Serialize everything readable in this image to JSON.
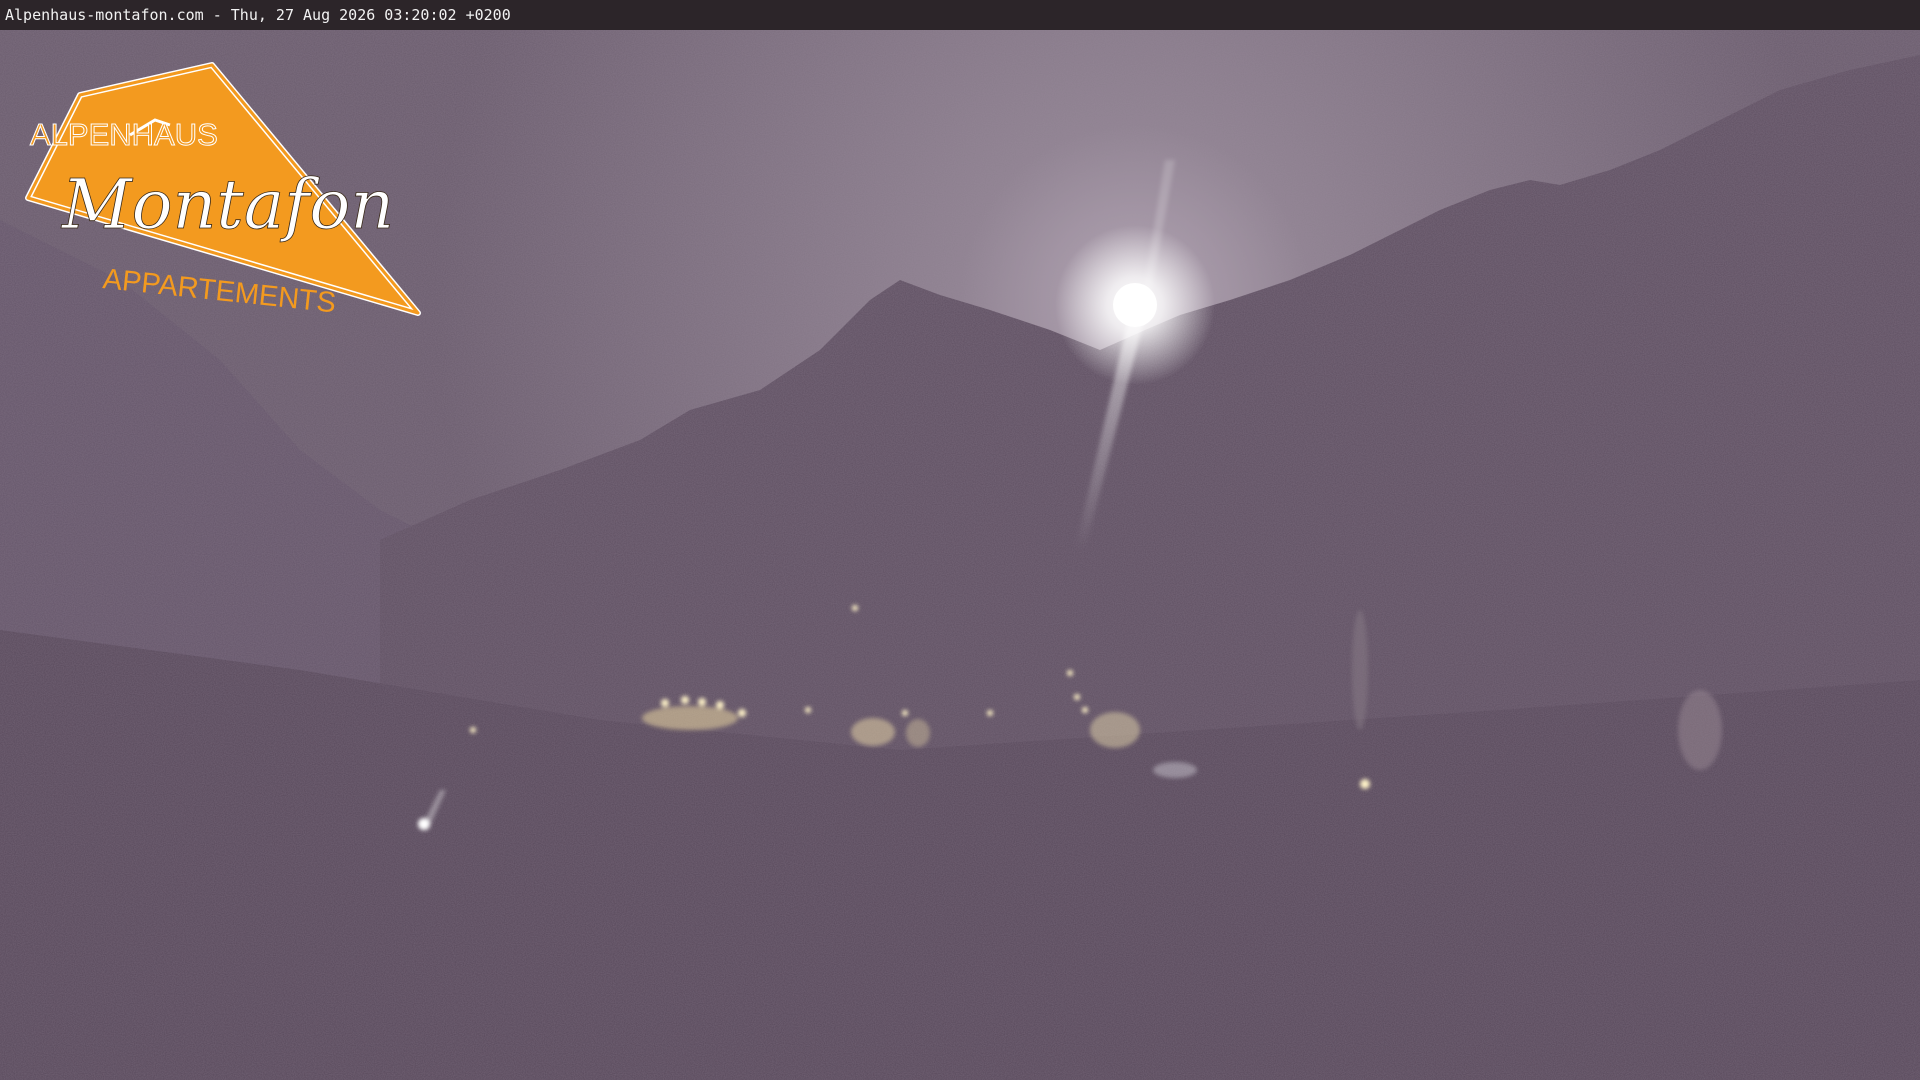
{
  "header": {
    "caption": "Alpenhaus-montafon.com - Thu, 27 Aug 2026 03:20:02 +0200"
  },
  "logo": {
    "line1": "ALPENHAUS",
    "line2": "Montafon",
    "line3": "APPARTEMENTS",
    "color": "#f39a1f"
  },
  "scene": {
    "sky_color": "#756878",
    "mountain_color": "#5a4a5c",
    "moon_color": "#ffffff",
    "light_color": "#ffe8a8"
  }
}
